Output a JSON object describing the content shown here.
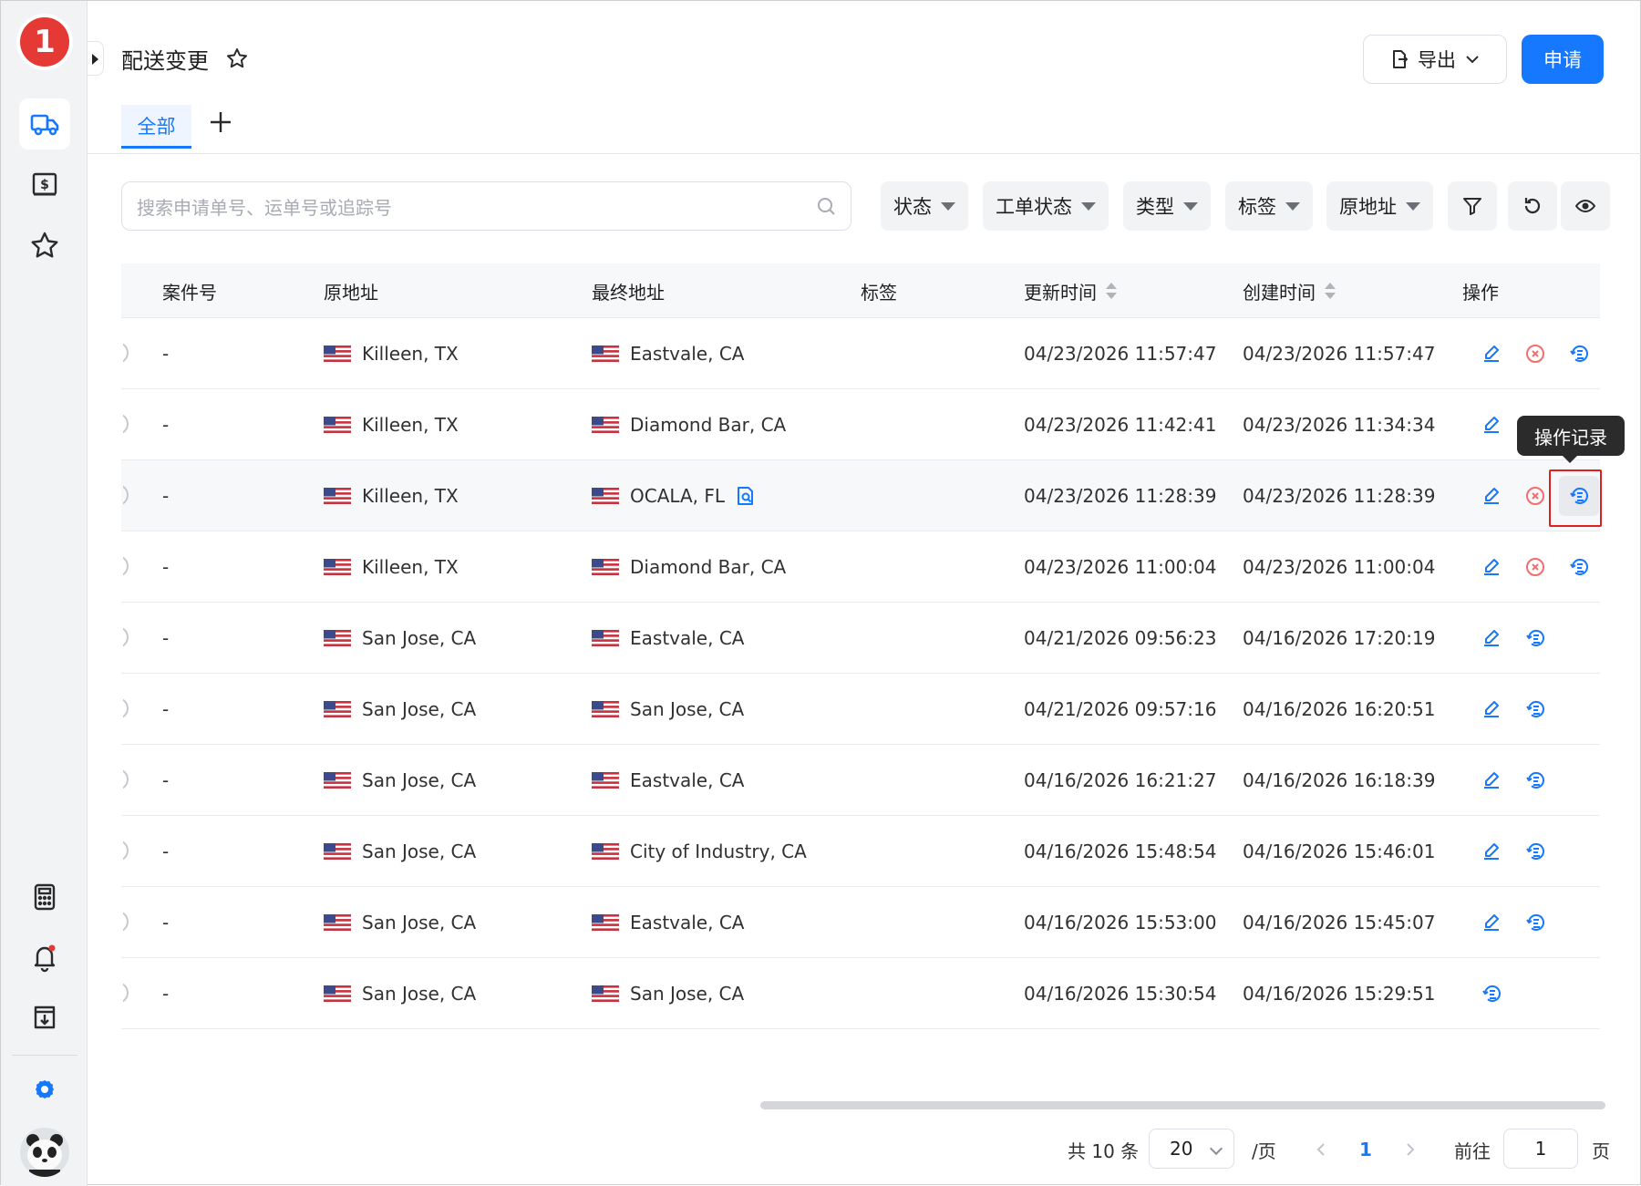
{
  "header": {
    "title": "配送变更",
    "export_label": "导出",
    "apply_label": "申请"
  },
  "tabs": [
    {
      "label": "全部",
      "active": true
    }
  ],
  "search": {
    "placeholder": "搜索申请单号、运单号或追踪号"
  },
  "filters": [
    "状态",
    "工单状态",
    "类型",
    "标签",
    "原地址"
  ],
  "table": {
    "columns": [
      "案件号",
      "原地址",
      "最终地址",
      "标签",
      "更新时间",
      "创建时间",
      "操作"
    ],
    "rows": [
      {
        "case_no": "-",
        "origin": "Killeen, TX",
        "destination": "Eastvale, CA",
        "tag": "",
        "updated": "04/23/2026 11:57:47",
        "created": "04/23/2026 11:57:47",
        "actions": [
          "edit",
          "cancel",
          "history"
        ]
      },
      {
        "case_no": "-",
        "origin": "Killeen, TX",
        "destination": "Diamond Bar, CA",
        "tag": "",
        "updated": "04/23/2026 11:42:41",
        "created": "04/23/2026 11:34:34",
        "actions": [
          "edit",
          "cancel",
          "history"
        ]
      },
      {
        "case_no": "-",
        "origin": "Killeen, TX",
        "destination": "OCALA, FL",
        "tag": "",
        "updated": "04/23/2026 11:28:39",
        "created": "04/23/2026 11:28:39",
        "actions": [
          "edit",
          "cancel",
          "history"
        ],
        "address_check_icon": true
      },
      {
        "case_no": "-",
        "origin": "Killeen, TX",
        "destination": "Diamond Bar, CA",
        "tag": "",
        "updated": "04/23/2026 11:00:04",
        "created": "04/23/2026 11:00:04",
        "actions": [
          "edit",
          "cancel",
          "history"
        ]
      },
      {
        "case_no": "-",
        "origin": "San Jose, CA",
        "destination": "Eastvale, CA",
        "tag": "",
        "updated": "04/21/2026 09:56:23",
        "created": "04/16/2026 17:20:19",
        "actions": [
          "edit",
          "history"
        ]
      },
      {
        "case_no": "-",
        "origin": "San Jose, CA",
        "destination": "San Jose, CA",
        "tag": "",
        "updated": "04/21/2026 09:57:16",
        "created": "04/16/2026 16:20:51",
        "actions": [
          "edit",
          "history"
        ]
      },
      {
        "case_no": "-",
        "origin": "San Jose, CA",
        "destination": "Eastvale, CA",
        "tag": "",
        "updated": "04/16/2026 16:21:27",
        "created": "04/16/2026 16:18:39",
        "actions": [
          "edit",
          "history"
        ]
      },
      {
        "case_no": "-",
        "origin": "San Jose, CA",
        "destination": "City of Industry, CA",
        "tag": "",
        "updated": "04/16/2026 15:48:54",
        "created": "04/16/2026 15:46:01",
        "actions": [
          "edit",
          "history"
        ]
      },
      {
        "case_no": "-",
        "origin": "San Jose, CA",
        "destination": "Eastvale, CA",
        "tag": "",
        "updated": "04/16/2026 15:53:00",
        "created": "04/16/2026 15:45:07",
        "actions": [
          "edit",
          "history"
        ]
      },
      {
        "case_no": "-",
        "origin": "San Jose, CA",
        "destination": "San Jose, CA",
        "tag": "",
        "updated": "04/16/2026 15:30:54",
        "created": "04/16/2026 15:29:51",
        "actions": [
          "history"
        ]
      }
    ]
  },
  "tooltip": {
    "text": "操作记录"
  },
  "pagination": {
    "total_label": "共 10 条",
    "page_size": "20",
    "per_page_label": "/页",
    "current_page": "1",
    "goto_label": "前往",
    "goto_value": "1",
    "page_unit": "页"
  },
  "sidebar": {
    "logo_text": "1",
    "items": [
      "truck-icon",
      "invoice-icon",
      "star-icon"
    ],
    "bottom_items": [
      "calculator-icon",
      "bell-icon",
      "download-icon",
      "settings-icon"
    ]
  },
  "colors": {
    "accent": "#1677ff",
    "danger": "#f56c6c",
    "logo_red": "#e53935"
  }
}
